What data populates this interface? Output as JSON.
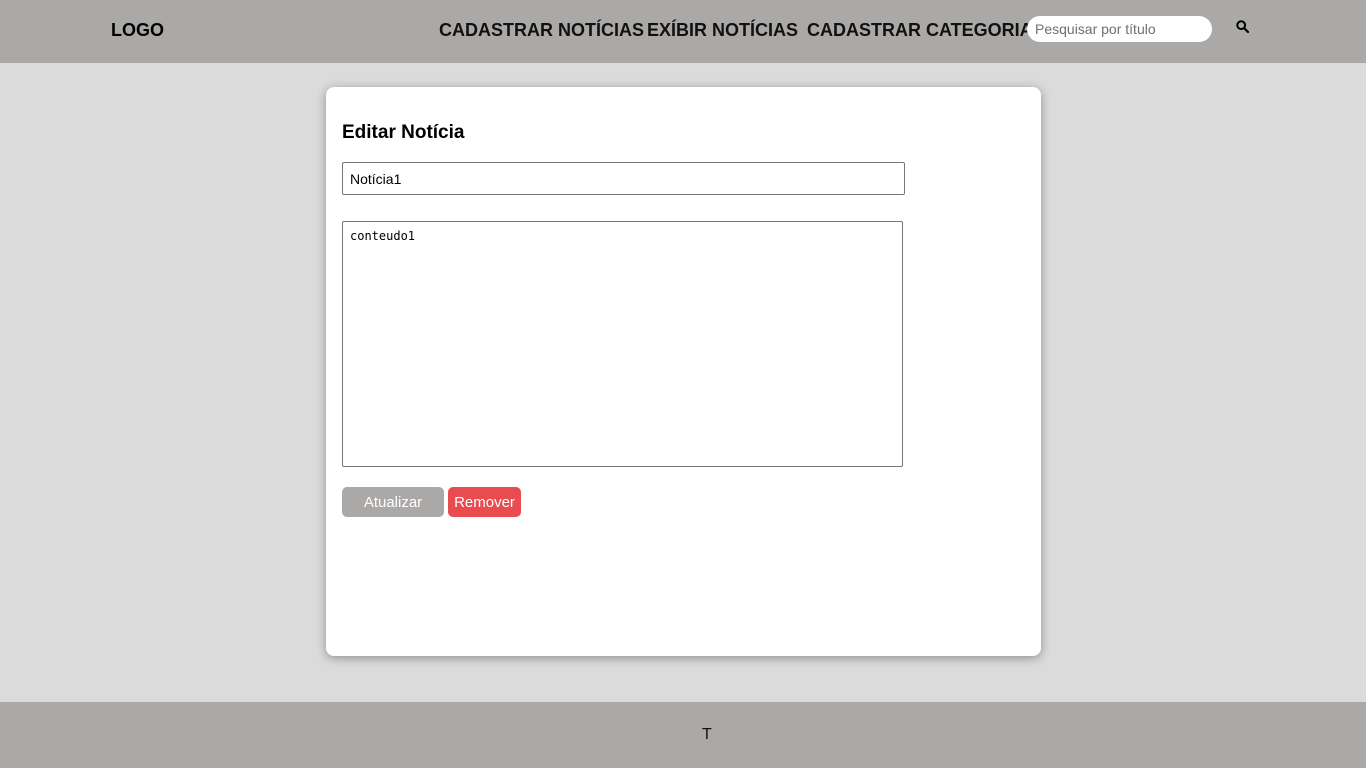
{
  "header": {
    "logo": "LOGO",
    "nav": [
      {
        "label": "CADASTRAR NOTÍCIAS"
      },
      {
        "label": "EXÍBIR NOTÍCIAS"
      },
      {
        "label": "CADASTRAR CATEGORIA"
      }
    ],
    "search": {
      "placeholder": "Pesquisar por título",
      "value": "",
      "icon": "search-icon"
    }
  },
  "form": {
    "heading": "Editar Notícia",
    "title_value": "Notícia1",
    "content_value": "conteudo1",
    "update_label": "Atualizar",
    "remove_label": "Remover"
  },
  "footer": {
    "text": "T"
  },
  "colors": {
    "header_bg": "#aaa9a7",
    "page_bg": "#dbdbdb",
    "update_button": "#aaa9a7",
    "remove_button": "#e84c4f"
  }
}
